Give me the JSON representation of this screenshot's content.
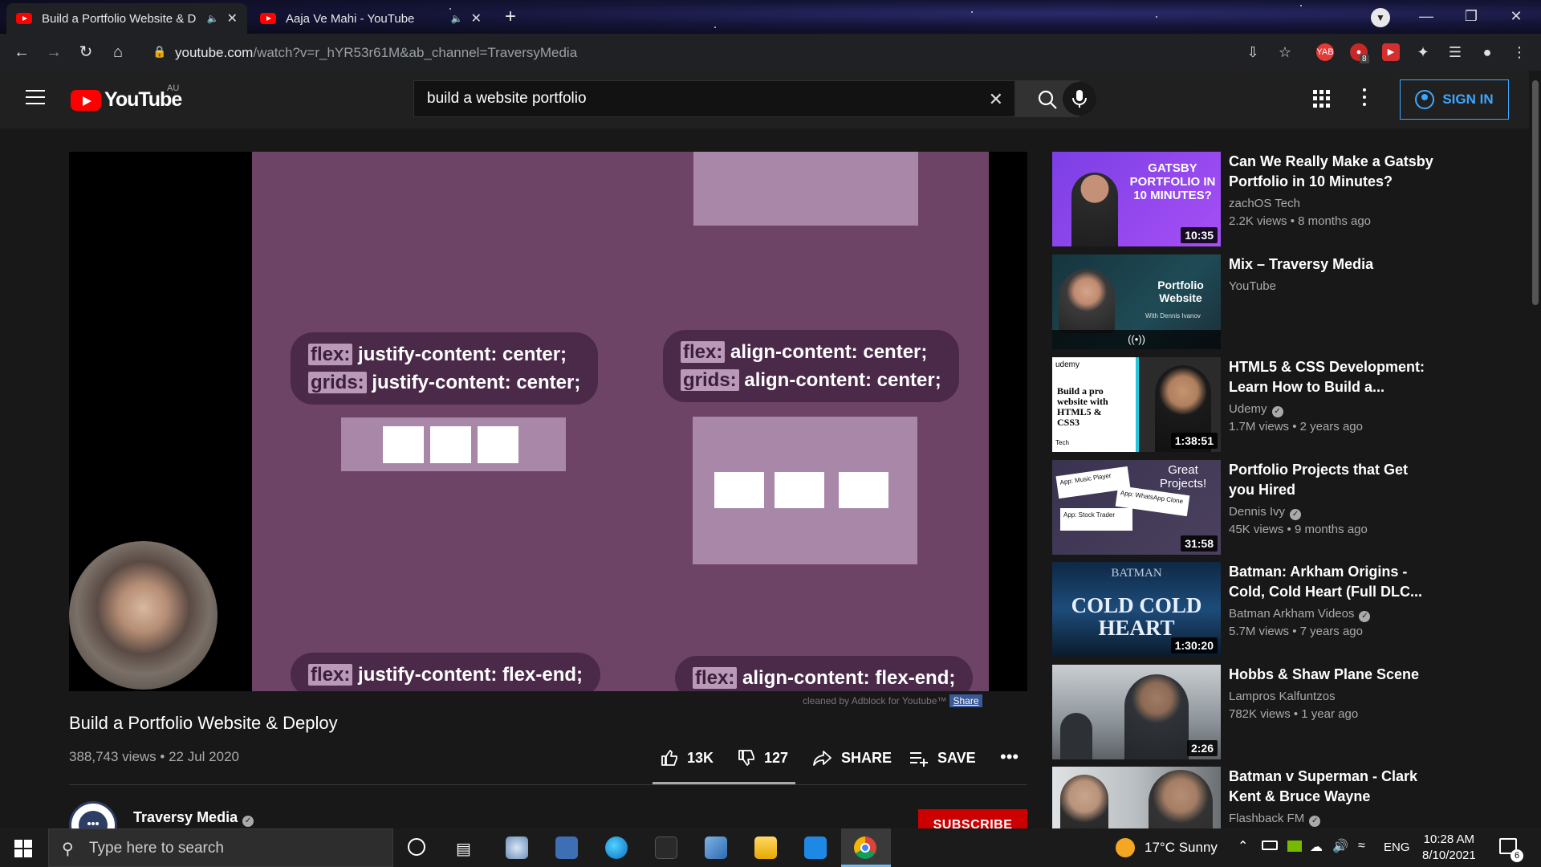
{
  "browser": {
    "tabs": [
      {
        "title": "Build a Portfolio Website & D",
        "active": true
      },
      {
        "title": "Aaja Ve Mahi - YouTube",
        "active": false
      }
    ],
    "new_tab_label": "+",
    "url_host": "youtube.com",
    "url_path": "/watch?v=r_hYR53r61M&ab_channel=TraversyMedia",
    "extension_badge": "8"
  },
  "youtube": {
    "logo_text": "YouTube",
    "region": "AU",
    "search_value": "build a website portfolio",
    "sign_in_label": "SIGN IN"
  },
  "player": {
    "slide": {
      "top_left_kw1": "flex:",
      "top_left_code1": " justify-content: center;",
      "top_left_kw2": "grids:",
      "top_left_code2": " justify-content: center;",
      "top_right_kw1": "flex:",
      "top_right_code1": " align-content: center;",
      "top_right_kw2": "grids:",
      "top_right_code2": " align-content: center;",
      "bottom_left_kw": "flex:",
      "bottom_left_code": " justify-content: flex-end;",
      "bottom_right_kw": "flex:",
      "bottom_right_code": " align-content: flex-end;"
    },
    "adblock_note": "cleaned by Adblock for Youtube™",
    "adblock_share": "Share"
  },
  "video": {
    "title": "Build a Portfolio Website & Deploy",
    "meta": "388,743 views • 22 Jul 2020",
    "likes": "13K",
    "dislikes": "127",
    "share_label": "SHARE",
    "save_label": "SAVE",
    "channel": "Traversy Media",
    "subscribe_label": "SUBSCRIBE"
  },
  "recommendations": [
    {
      "title": "Can We Really Make a Gatsby Portfolio in 10 Minutes?",
      "channel": "zachOS Tech",
      "stats": "2.2K views • 8 months ago",
      "duration": "10:35",
      "thumb_text": "GATSBY PORTFOLIO IN 10 MINUTES?",
      "verified": false
    },
    {
      "title": "Mix – Traversy Media",
      "channel": "YouTube",
      "stats": "",
      "duration": "",
      "thumb_text": "Portfolio Website",
      "thumb_sub": "With Dennis Ivanov",
      "live_icon": "((•))",
      "verified": false
    },
    {
      "title": "HTML5 & CSS Development: Learn How to Build a...",
      "channel": "Udemy",
      "stats": "1.7M views • 2 years ago",
      "duration": "1:38:51",
      "thumb_text": "Build a pro website with HTML5 & CSS3",
      "thumb_brand": "udemy",
      "thumb_sub": "Tech",
      "verified": true
    },
    {
      "title": "Portfolio Projects that Get you Hired",
      "channel": "Dennis Ivy",
      "stats": "45K views • 9 months ago",
      "duration": "31:58",
      "thumb_text": "Great Projects!",
      "thumb_cards": [
        "App: Music Player",
        "App: WhatsApp Clone",
        "App: Stock Trader"
      ],
      "verified": true
    },
    {
      "title": "Batman: Arkham Origins - Cold, Cold Heart (Full DLC...",
      "channel": "Batman Arkham Videos",
      "stats": "5.7M views • 7 years ago",
      "duration": "1:30:20",
      "thumb_text": "COLD COLD HEART",
      "thumb_brand": "BATMAN",
      "verified": true
    },
    {
      "title": "Hobbs & Shaw Plane Scene",
      "channel": "Lampros Kalfuntzos",
      "stats": "782K views • 1 year ago",
      "duration": "2:26",
      "thumb_text": "",
      "verified": false
    },
    {
      "title": "Batman v Superman - Clark Kent & Bruce Wayne",
      "channel": "Flashback FM",
      "stats": "",
      "duration": "",
      "thumb_text": "",
      "verified": true
    }
  ],
  "taskbar": {
    "search_placeholder": "Type here to search",
    "weather": "17°C  Sunny",
    "language": "ENG",
    "time": "10:28 AM",
    "date": "8/10/2021",
    "notification_count": "6"
  },
  "colors": {
    "youtube_red": "#ff0000",
    "link_blue": "#3ea6ff",
    "slide_bg": "#6e4466",
    "subscribe_red": "#cc0000"
  }
}
